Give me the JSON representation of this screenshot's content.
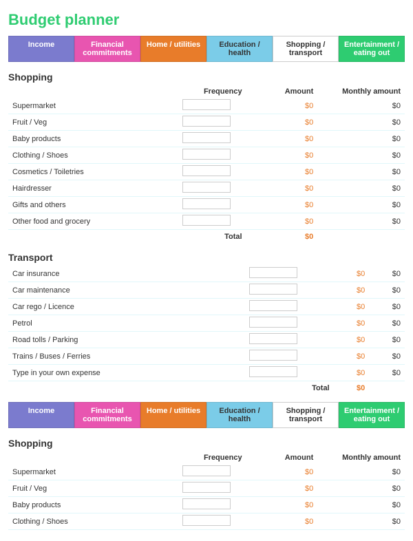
{
  "title": "Budget planner",
  "tabs": [
    {
      "id": "income",
      "label": "Income",
      "class": "tab-income"
    },
    {
      "id": "financial",
      "label": "Financial commitments",
      "class": "tab-financial"
    },
    {
      "id": "home",
      "label": "Home / utilities",
      "class": "tab-home"
    },
    {
      "id": "education",
      "label": "Education / health",
      "class": "tab-education"
    },
    {
      "id": "shopping",
      "label": "Shopping / transport",
      "class": "tab-shopping"
    },
    {
      "id": "entertainment",
      "label": "Entertainment / eating out",
      "class": "tab-entertainment"
    }
  ],
  "section1_title": "Shopping",
  "col_freq": "Frequency",
  "col_amount": "Amount",
  "col_monthly": "Monthly amount",
  "shopping_items": [
    "Supermarket",
    "Fruit / Veg",
    "Baby products",
    "Clothing / Shoes",
    "Cosmetics / Toiletries",
    "Hairdresser",
    "Gifts and others",
    "Other food and grocery"
  ],
  "transport_title": "Transport",
  "transport_items": [
    "Car insurance",
    "Car maintenance",
    "Car rego / Licence",
    "Petrol",
    "Road tolls / Parking",
    "Trains / Buses / Ferries",
    "Type in your own expense"
  ],
  "total_label": "Total",
  "zero": "$0",
  "section2_title": "Shopping",
  "shopping_items2": [
    "Supermarket",
    "Fruit / Veg",
    "Baby products",
    "Clothing / Shoes"
  ]
}
